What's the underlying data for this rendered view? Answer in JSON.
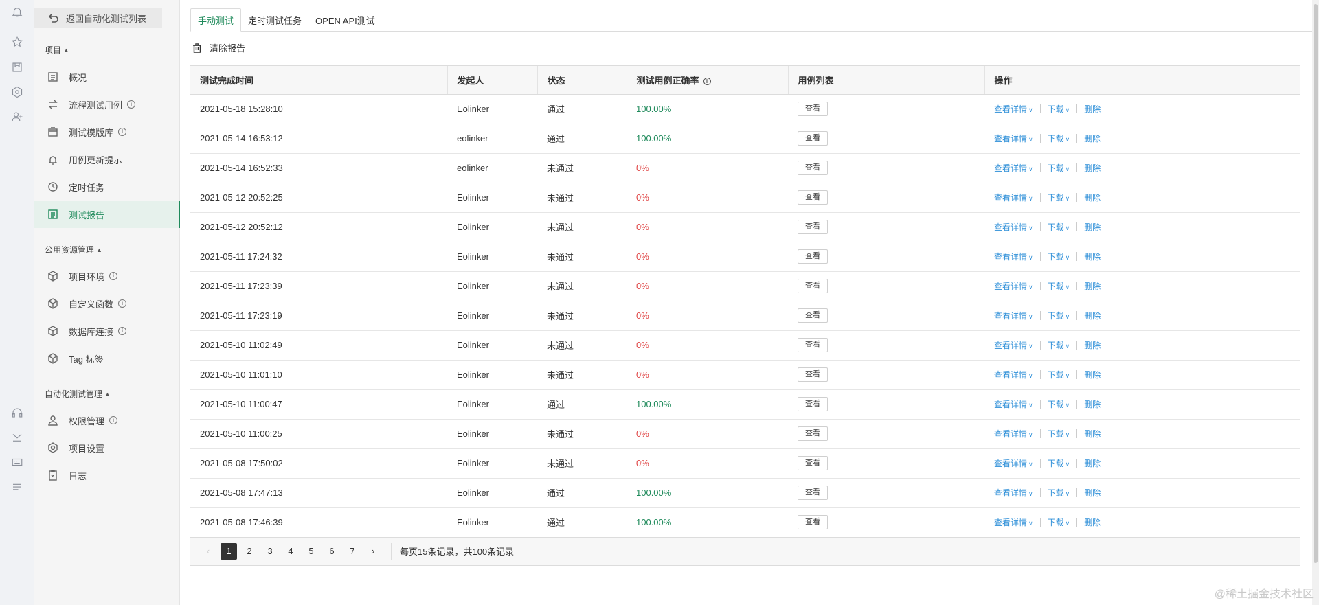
{
  "back_label": "返回自动化测试列表",
  "sidebar": {
    "groups": [
      {
        "title": "项目",
        "items": [
          {
            "label": "概况",
            "icon": "overview-icon"
          },
          {
            "label": "流程测试用例",
            "icon": "flow-icon",
            "info": true
          },
          {
            "label": "测试模版库",
            "icon": "template-icon",
            "info": true
          },
          {
            "label": "用例更新提示",
            "icon": "bell-icon"
          },
          {
            "label": "定时任务",
            "icon": "clock-icon"
          },
          {
            "label": "测试报告",
            "icon": "report-icon",
            "active": true
          }
        ]
      },
      {
        "title": "公用资源管理",
        "items": [
          {
            "label": "项目环境",
            "icon": "cube-icon",
            "info": true
          },
          {
            "label": "自定义函数",
            "icon": "cube-icon",
            "info": true
          },
          {
            "label": "数据库连接",
            "icon": "cube-icon",
            "info": true
          },
          {
            "label": "Tag 标签",
            "icon": "cube-icon"
          }
        ]
      },
      {
        "title": "自动化测试管理",
        "items": [
          {
            "label": "权限管理",
            "icon": "permission-icon",
            "info": true
          },
          {
            "label": "项目设置",
            "icon": "settings-icon"
          },
          {
            "label": "日志",
            "icon": "log-icon"
          }
        ]
      }
    ]
  },
  "tabs": [
    "手动测试",
    "定时测试任务",
    "OPEN API测试"
  ],
  "toolbar": {
    "clear_label": "清除报告"
  },
  "table": {
    "headers": [
      "测试完成时间",
      "发起人",
      "状态",
      "测试用例正确率",
      "用例列表",
      "操作"
    ],
    "view_label": "查看",
    "ops": {
      "detail": "查看详情",
      "download": "下载",
      "delete": "删除"
    },
    "rows": [
      {
        "time": "2021-05-18 15:28:10",
        "user": "Eolinker",
        "status": "通过",
        "rate": "100.00%",
        "pass": true
      },
      {
        "time": "2021-05-14 16:53:12",
        "user": "eolinker",
        "status": "通过",
        "rate": "100.00%",
        "pass": true
      },
      {
        "time": "2021-05-14 16:52:33",
        "user": "eolinker",
        "status": "未通过",
        "rate": "0%",
        "pass": false
      },
      {
        "time": "2021-05-12 20:52:25",
        "user": "Eolinker",
        "status": "未通过",
        "rate": "0%",
        "pass": false
      },
      {
        "time": "2021-05-12 20:52:12",
        "user": "Eolinker",
        "status": "未通过",
        "rate": "0%",
        "pass": false
      },
      {
        "time": "2021-05-11 17:24:32",
        "user": "Eolinker",
        "status": "未通过",
        "rate": "0%",
        "pass": false
      },
      {
        "time": "2021-05-11 17:23:39",
        "user": "Eolinker",
        "status": "未通过",
        "rate": "0%",
        "pass": false
      },
      {
        "time": "2021-05-11 17:23:19",
        "user": "Eolinker",
        "status": "未通过",
        "rate": "0%",
        "pass": false
      },
      {
        "time": "2021-05-10 11:02:49",
        "user": "Eolinker",
        "status": "未通过",
        "rate": "0%",
        "pass": false
      },
      {
        "time": "2021-05-10 11:01:10",
        "user": "Eolinker",
        "status": "未通过",
        "rate": "0%",
        "pass": false
      },
      {
        "time": "2021-05-10 11:00:47",
        "user": "Eolinker",
        "status": "通过",
        "rate": "100.00%",
        "pass": true
      },
      {
        "time": "2021-05-10 11:00:25",
        "user": "Eolinker",
        "status": "未通过",
        "rate": "0%",
        "pass": false
      },
      {
        "time": "2021-05-08 17:50:02",
        "user": "Eolinker",
        "status": "未通过",
        "rate": "0%",
        "pass": false
      },
      {
        "time": "2021-05-08 17:47:13",
        "user": "Eolinker",
        "status": "通过",
        "rate": "100.00%",
        "pass": true
      },
      {
        "time": "2021-05-08 17:46:39",
        "user": "Eolinker",
        "status": "通过",
        "rate": "100.00%",
        "pass": true
      }
    ]
  },
  "pagination": {
    "pages": [
      "1",
      "2",
      "3",
      "4",
      "5",
      "6",
      "7"
    ],
    "current": "1",
    "summary": "每页15条记录，共100条记录"
  },
  "watermark": "@稀土掘金技术社区",
  "colors": {
    "accent": "#1f8a5b",
    "fail": "#e04545",
    "link": "#2e8fd8"
  }
}
